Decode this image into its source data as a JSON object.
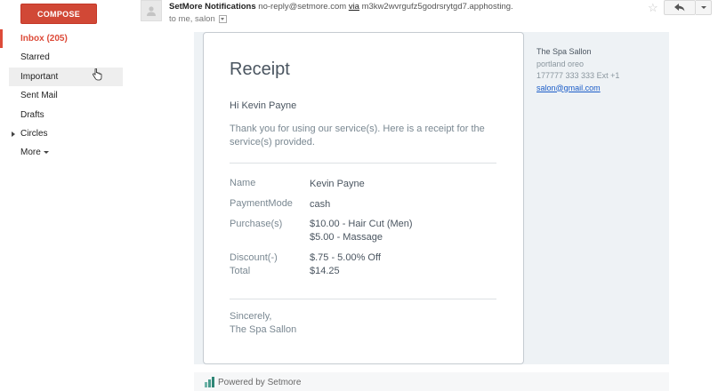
{
  "sidebar": {
    "compose_label": "COMPOSE",
    "items": [
      {
        "label": "Inbox (205)"
      },
      {
        "label": "Starred"
      },
      {
        "label": "Important"
      },
      {
        "label": "Sent Mail"
      },
      {
        "label": "Drafts"
      },
      {
        "label": "Circles"
      },
      {
        "label": "More"
      }
    ]
  },
  "header": {
    "sender_name": "SetMore Notifications",
    "sender_email": "no-reply@setmore.com",
    "via_label": "via",
    "via_domain": "m3kw2wvrgufz5godrsrytgd7.apphosting.",
    "recipients": "to me, salon"
  },
  "receipt": {
    "title": "Receipt",
    "greeting": "Hi Kevin Payne",
    "thankyou": "Thank you for using our service(s). Here is a receipt for the service(s) provided.",
    "name_label": "Name",
    "name_value": "Kevin Payne",
    "payment_label": "PaymentMode",
    "payment_value": "cash",
    "purchase_label": "Purchase(s)",
    "purchase_1": "$10.00 - Hair Cut (Men)",
    "purchase_2": "$5.00 - Massage",
    "discount_label": "Discount(-)",
    "discount_value": "$.75 - 5.00% Off",
    "total_label": "Total",
    "total_value": "$14.25",
    "signoff_1": "Sincerely,",
    "signoff_2": "The Spa Sallon"
  },
  "business": {
    "name": "The Spa Sallon",
    "address": "portland oreo",
    "phone": "177777 333 333 Ext +1",
    "email": "salon@gmail.com"
  },
  "footer": {
    "powered_by": "Powered by Setmore"
  },
  "colors": {
    "compose": "#d14836",
    "active_nav": "#dd4b39",
    "link": "#1a5cc8"
  }
}
